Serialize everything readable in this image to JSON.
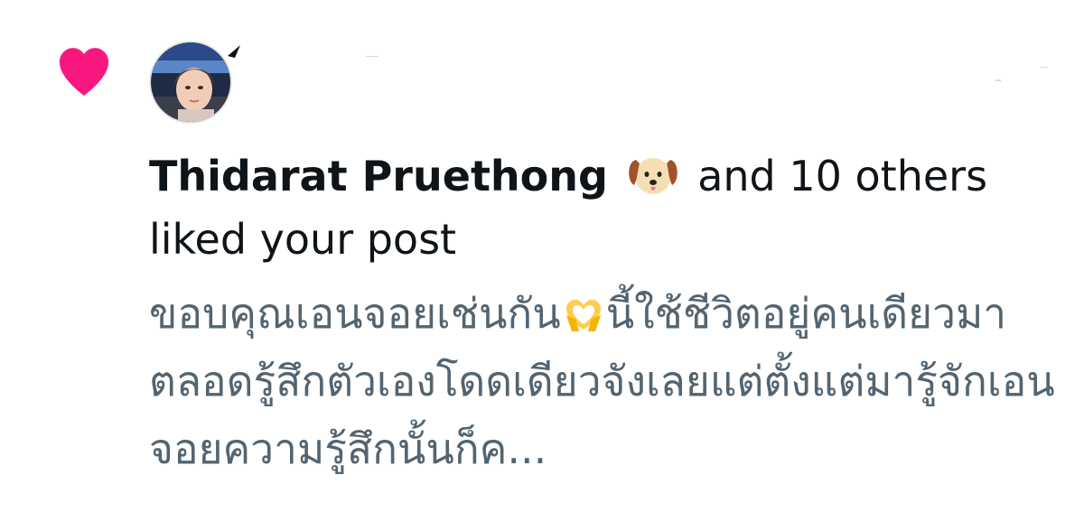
{
  "notification": {
    "type_icon": "heart-icon",
    "accent_color": "#f91880",
    "actor_name": "Thidarat Pruethong",
    "actor_emoji": "dog-face-icon",
    "others_text": " and 10 others liked your post",
    "post_preview": {
      "part1": "ขอบคุณเอนจอยเช่นกัน",
      "emoji": "heart-hands-icon",
      "part2": "นี้ใช้ชีวิตอยู่คนเดียวมาตลอดรู้สึกตัวเองโดดเดียวจังเลยแต่ตั้งแต่มารู้จักเอนจอยความรู้สึกนั้นก็ค..."
    }
  },
  "colors": {
    "heart": "#f91880",
    "primary_text": "#0f1419",
    "secondary_text": "#536471",
    "background": "#ffffff"
  }
}
